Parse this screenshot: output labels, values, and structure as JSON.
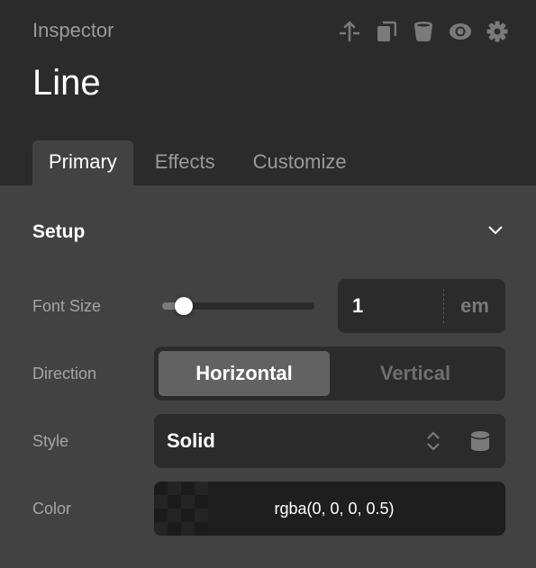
{
  "header": {
    "panel_label": "Inspector",
    "element_title": "Line",
    "toolbar": [
      {
        "name": "insert-divider-icon"
      },
      {
        "name": "duplicate-icon"
      },
      {
        "name": "delete-icon"
      },
      {
        "name": "visibility-icon"
      },
      {
        "name": "settings-icon"
      }
    ]
  },
  "tabs": [
    {
      "label": "Primary",
      "active": true
    },
    {
      "label": "Effects",
      "active": false
    },
    {
      "label": "Customize",
      "active": false
    }
  ],
  "section": {
    "title": "Setup",
    "expanded": true,
    "toggle_icon": "chevron-down-icon"
  },
  "fields": {
    "font_size": {
      "label": "Font Size",
      "value": "1",
      "unit": "em",
      "slider_fraction": 0.14
    },
    "direction": {
      "label": "Direction",
      "options": [
        "Horizontal",
        "Vertical"
      ],
      "selected": "Horizontal"
    },
    "style": {
      "label": "Style",
      "value": "Solid"
    },
    "color": {
      "label": "Color",
      "value": "rgba(0, 0, 0, 0.5)"
    }
  },
  "colors": {
    "header_bg": "#2b2b2b",
    "panel_bg": "#424242",
    "control_bg": "#2b2b2b",
    "active_segment": "#626262",
    "icon_gray": "#7a7a7a",
    "text_primary": "#ffffff",
    "text_muted": "#9a9a9a"
  }
}
